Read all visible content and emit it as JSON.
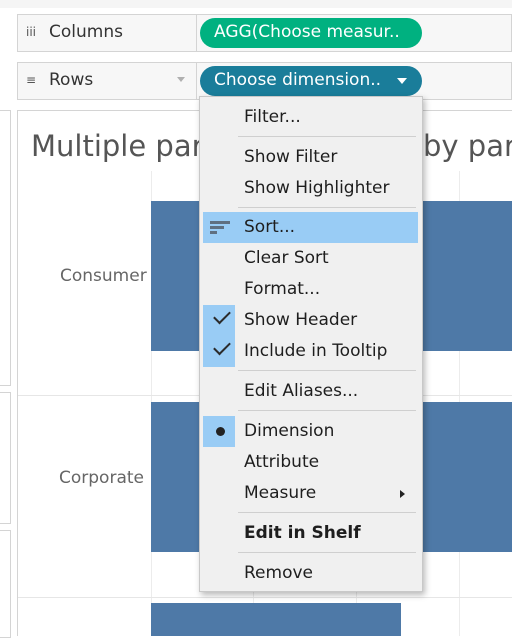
{
  "shelves": {
    "columns": {
      "label": "Columns",
      "icon": "iii",
      "pill": "AGG(Choose measur.."
    },
    "rows": {
      "label": "Rows",
      "icon": "≡",
      "pill": "Choose dimension.."
    }
  },
  "viz": {
    "title_left": "Multiple par",
    "title_right": "by para",
    "chart_data": {
      "type": "bar",
      "categories": [
        "Consumer",
        "Corporate",
        ""
      ],
      "values": [
        null,
        null,
        null
      ],
      "title": "",
      "xlabel": "",
      "ylabel": ""
    }
  },
  "context_menu": {
    "items": {
      "filter": "Filter...",
      "show_filter": "Show Filter",
      "show_highlighter": "Show Highlighter",
      "sort": "Sort...",
      "clear_sort": "Clear Sort",
      "format": "Format...",
      "show_header": "Show Header",
      "include_tooltip": "Include in Tooltip",
      "edit_aliases": "Edit Aliases...",
      "dimension": "Dimension",
      "attribute": "Attribute",
      "measure": "Measure",
      "edit_in_shelf": "Edit in Shelf",
      "remove": "Remove"
    },
    "selected": "Sort...",
    "checked": [
      "Show Header",
      "Include in Tooltip"
    ],
    "radio_selected": "Dimension"
  },
  "colors": {
    "bar": "#4e79a7",
    "measure_pill": "#00b180",
    "dimension_pill": "#1a7d9a",
    "highlight": "#99ccf5"
  }
}
